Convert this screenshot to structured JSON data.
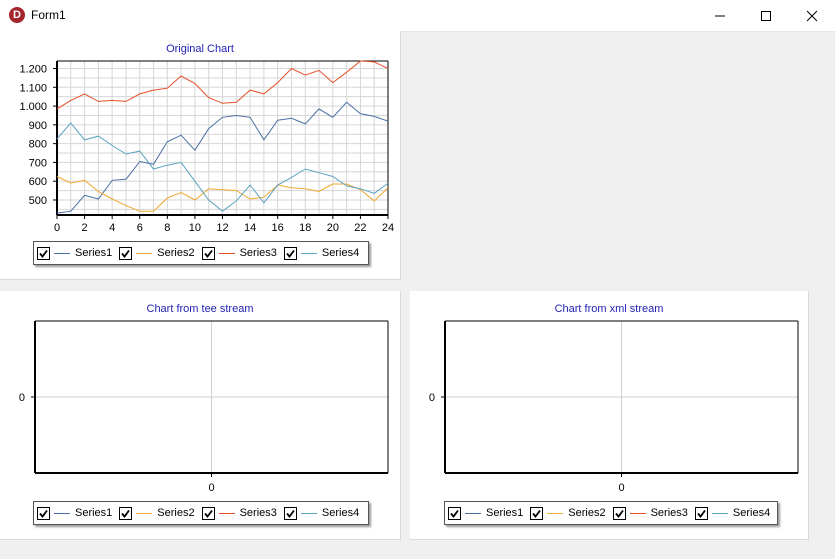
{
  "window": {
    "title": "Form1",
    "app_icon_letter": "D"
  },
  "charts": [
    {
      "title": "Original Chart",
      "chart_data": {
        "type": "line",
        "title": "Original Chart",
        "x": [
          0,
          1,
          2,
          3,
          4,
          5,
          6,
          7,
          8,
          9,
          10,
          11,
          12,
          13,
          14,
          15,
          16,
          17,
          18,
          19,
          20,
          21,
          22,
          23,
          24
        ],
        "xticks": [
          0,
          2,
          4,
          6,
          8,
          10,
          12,
          14,
          16,
          18,
          20,
          22,
          24
        ],
        "xlim": [
          0,
          24
        ],
        "yticks": [
          "500",
          "600",
          "700",
          "800",
          "900",
          "1.000",
          "1.100",
          "1.200"
        ],
        "ytick_values": [
          500,
          600,
          700,
          800,
          900,
          1000,
          1100,
          1200
        ],
        "ylim": [
          420,
          1240
        ],
        "grid": true,
        "legend": "bottom",
        "series": [
          {
            "name": "Series1",
            "color": "#4a6fa5",
            "values": [
              430,
              440,
              525,
              505,
              605,
              610,
              705,
              690,
              810,
              845,
              765,
              880,
              940,
              950,
              940,
              820,
              925,
              935,
              905,
              985,
              940,
              1020,
              960,
              945,
              920
            ]
          },
          {
            "name": "Series2",
            "color": "#f0a830",
            "values": [
              625,
              590,
              605,
              545,
              505,
              470,
              440,
              440,
              510,
              540,
              500,
              560,
              555,
              550,
              505,
              515,
              580,
              565,
              560,
              545,
              585,
              585,
              555,
              495,
              565
            ]
          },
          {
            "name": "Series3",
            "color": "#e8502a",
            "values": [
              985,
              1030,
              1065,
              1025,
              1030,
              1025,
              1065,
              1085,
              1095,
              1160,
              1120,
              1045,
              1015,
              1020,
              1085,
              1065,
              1125,
              1200,
              1165,
              1190,
              1125,
              1180,
              1240,
              1235,
              1200
            ]
          },
          {
            "name": "Series4",
            "color": "#5ba3c0",
            "values": [
              825,
              910,
              820,
              840,
              790,
              745,
              760,
              665,
              685,
              700,
              600,
              500,
              440,
              495,
              580,
              485,
              580,
              620,
              665,
              645,
              625,
              575,
              560,
              535,
              590
            ]
          }
        ]
      }
    },
    {
      "title": "Chart from tee stream",
      "chart_data": {
        "type": "line",
        "title": "Chart from tee stream",
        "x": [],
        "series": [
          {
            "name": "Series1",
            "color": "#4a6fa5",
            "values": []
          },
          {
            "name": "Series2",
            "color": "#f0a830",
            "values": []
          },
          {
            "name": "Series3",
            "color": "#e8502a",
            "values": []
          },
          {
            "name": "Series4",
            "color": "#5ba3c0",
            "values": []
          }
        ],
        "xticks": [
          0
        ],
        "yticks": [
          "0"
        ],
        "grid": true,
        "legend": "bottom"
      }
    },
    {
      "title": "Chart from xml stream",
      "chart_data": {
        "type": "line",
        "title": "Chart from xml stream",
        "x": [],
        "series": [
          {
            "name": "Series1",
            "color": "#4a6fa5",
            "values": []
          },
          {
            "name": "Series2",
            "color": "#f0a830",
            "values": []
          },
          {
            "name": "Series3",
            "color": "#e8502a",
            "values": []
          },
          {
            "name": "Series4",
            "color": "#5ba3c0",
            "values": []
          }
        ],
        "xticks": [
          0
        ],
        "yticks": [
          "0"
        ],
        "grid": true,
        "legend": "bottom"
      }
    }
  ]
}
